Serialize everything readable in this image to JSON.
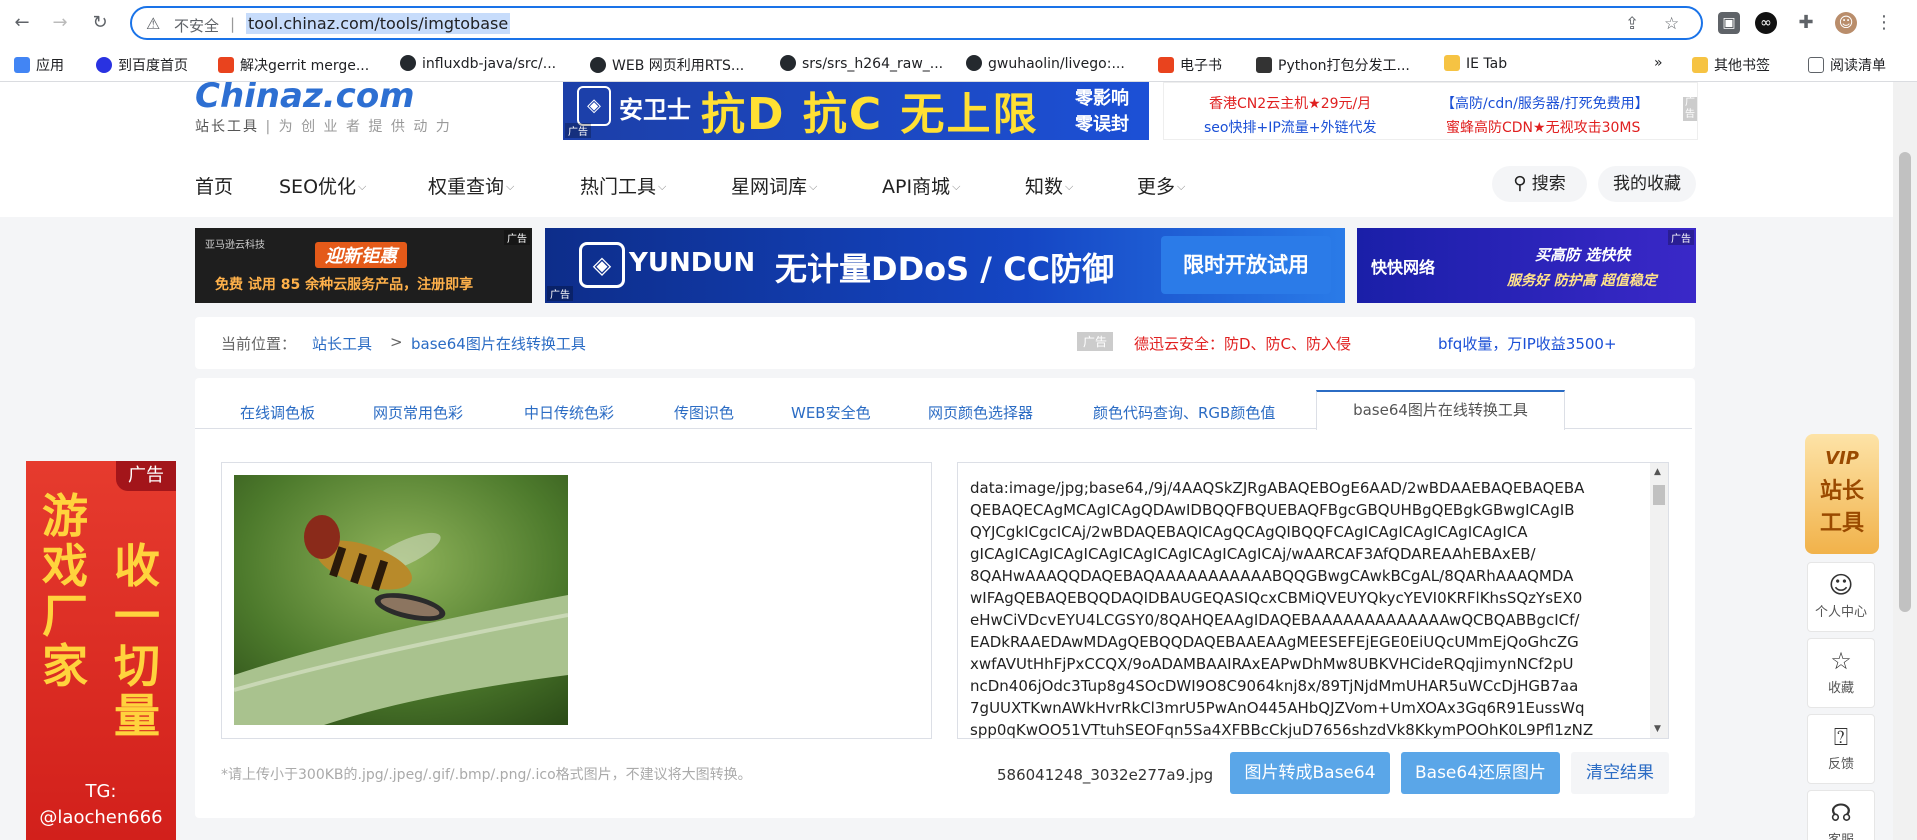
{
  "browser": {
    "insecure_label": "不安全",
    "separator": "|",
    "url": "tool.chinaz.com/tools/imgtobase",
    "bookmarks": [
      {
        "label": "应用",
        "color": "#4285f4"
      },
      {
        "label": "到百度首页",
        "color": "#2932e1"
      },
      {
        "label": "解决gerrit merge...",
        "color": "#e9431e"
      },
      {
        "label": "influxdb-java/src/...",
        "color": "#24292e"
      },
      {
        "label": "WEB 网页利用RTS...",
        "color": "#24292e"
      },
      {
        "label": "srs/srs_h264_raw_...",
        "color": "#24292e"
      },
      {
        "label": "gwuhaolin/livego:...",
        "color": "#24292e"
      },
      {
        "label": "电子书",
        "color": "#e9431e"
      },
      {
        "label": "Python打包分发工...",
        "color": "#333333"
      },
      {
        "label": "IE Tab",
        "color": "#f6c343"
      }
    ],
    "more_bookmarks": "»",
    "other_bookmarks": "其他书签",
    "reading_list": "阅读清单"
  },
  "header": {
    "logo_text": "Chinaz.com",
    "logo_sub": "站长工具",
    "logo_slogan": "| 为 创 业 者 提 供 动 力",
    "ad_anweishi": {
      "brand": "安卫士",
      "slogan": "抗D 抗C 无上限",
      "side1": "零影响",
      "side2": "零误封",
      "tag": "广告"
    },
    "text_ads": [
      {
        "text": "香港CN2云主机★29元/月",
        "color": "#e02020"
      },
      {
        "text": "【高防/cdn/服务器/打死免费用】",
        "color": "#1a4fd6"
      },
      {
        "text": "seo快排+IP流量+外链代发",
        "color": "#1a4fd6"
      },
      {
        "text": "蜜蜂高防CDN★无视攻击30MS",
        "color": "#e02020"
      }
    ],
    "text_ads_tag": "广告"
  },
  "nav": {
    "items": [
      {
        "label": "首页",
        "dropdown": false
      },
      {
        "label": "SEO优化",
        "dropdown": true
      },
      {
        "label": "权重查询",
        "dropdown": true
      },
      {
        "label": "热门工具",
        "dropdown": true
      },
      {
        "label": "星网词库",
        "dropdown": true
      },
      {
        "label": "API商城",
        "dropdown": true
      },
      {
        "label": "知数",
        "dropdown": true
      },
      {
        "label": "更多",
        "dropdown": true
      }
    ],
    "chevron": "⌵",
    "search_label": "搜索",
    "favorites_label": "我的收藏"
  },
  "banner_ads": {
    "aws": {
      "brand": "亚马逊云科技",
      "title": "迎新钜惠",
      "line": "免费 试用 85 余种云服务产品，注册即享",
      "tag": "广告"
    },
    "yundun": {
      "brand": "YUNDUN",
      "title": "无计量DDoS / CC防御",
      "cta": "限时开放试用",
      "tag": "广告"
    },
    "kuaikuai": {
      "brand": "快快网络",
      "line1": "买高防 选快快",
      "line2": "服务好 防护高 超值稳定",
      "tag": "广告"
    }
  },
  "breadcrumb": {
    "prefix": "当前位置：",
    "home": "站长工具",
    "separator": ">",
    "current": "base64图片在线转换工具",
    "ad_tag": "广告",
    "ad1": "德迅云安全：防D、防C、防入侵",
    "ad2": "bfq收量，万IP收益3500+"
  },
  "tabs": [
    {
      "label": "在线调色板"
    },
    {
      "label": "网页常用色彩"
    },
    {
      "label": "中日传统色彩"
    },
    {
      "label": "传图识色"
    },
    {
      "label": "WEB安全色"
    },
    {
      "label": "网页颜色选择器"
    },
    {
      "label": "颜色代码查询、RGB颜色值"
    }
  ],
  "active_tab": "base64图片在线转换工具",
  "converter": {
    "base64_lines": [
      "data:image/jpg;base64,/9j/4AAQSkZJRgABAQEBOgE6AAD/2wBDAAEBAQEBAQEBA",
      "QEBAQECAgMCAgICAgQDAwIDBQQFBQUEBAQFBgcGBQUHBgQEBgkGBwgICAgIB",
      "QYJCgkICgcICAj/2wBDAQEBAQICAgQCAgQIBQQFCAgICAgICAgICAgICAgICA",
      "gICAgICAgICAgICAgICAgICAgICAgICAgICAj/wAARCAF3AfQDAREAAhEBAxEB/",
      "8QAHwAAAQQDAQEBAQAAAAAAAAAAABQQGBwgCAwkBCgAL/8QARhAAAQMDA",
      "wIFAgQEBAQEBQQDAQIDBAUGEQASIQcxCBMiQVEUYQkycYEVI0KRFlKhsSQzYsEX0",
      "eHwCiVDcvEYU4LCGSY0/8QAHQEAAgIDAQEBAAAAAAAAAAAAAwQCBQABBgcICf/",
      "EADkRAAEDAwMDAgQEBQQDAQEBAAEAAgMEESEFEjEGE0EiUQcUMmEjQoGhcZG",
      "xwfAVUtHhFjPxCCQX/9oADAMBAAIRAxEAPwDhMw8UBKVHCideRQqjimynNCf2pU",
      "ncDn406jOdc3Tup8g4SOcDWI9O8C9064knj8x/89TjNjdMmUHAR5uWCcDjHGB7aa",
      "7gUUXTKwnAWkHvrRkCl3mrU5PwAnO445AHbQJZVom+UmXOAx3Gq6R91EussWq",
      "spp0qKwOO51VTtuhSEOFqn5Sa4XFBBcCkjuD7656shzdVk8KkymPOOhK0L9Pfl1zNZ"
    ],
    "hint": "*请上传小于300KB的.jpg/.jpeg/.gif/.bmp/.png/.ico格式图片，不建议将大图转换。",
    "filename": "586041248_3032e277a9.jpg",
    "btn_to_base64": "图片转成Base64",
    "btn_restore": "Base64还原图片",
    "btn_clear": "清空结果"
  },
  "left_ad": {
    "tag": "广告",
    "col1": [
      "游",
      "戏",
      "厂",
      "家"
    ],
    "col2": [
      "收",
      "一",
      "切",
      "量"
    ],
    "tg_label": "TG:",
    "tg_handle": "@laochen666"
  },
  "side_tools": {
    "vip_line1": "VIP",
    "vip_line2": "站长",
    "vip_line3": "工具",
    "items": [
      {
        "label": "个人中心",
        "icon": "user-icon"
      },
      {
        "label": "收藏",
        "icon": "star-icon"
      },
      {
        "label": "反馈",
        "icon": "feedback-icon"
      },
      {
        "label": "客服",
        "icon": "headset-icon"
      }
    ]
  }
}
